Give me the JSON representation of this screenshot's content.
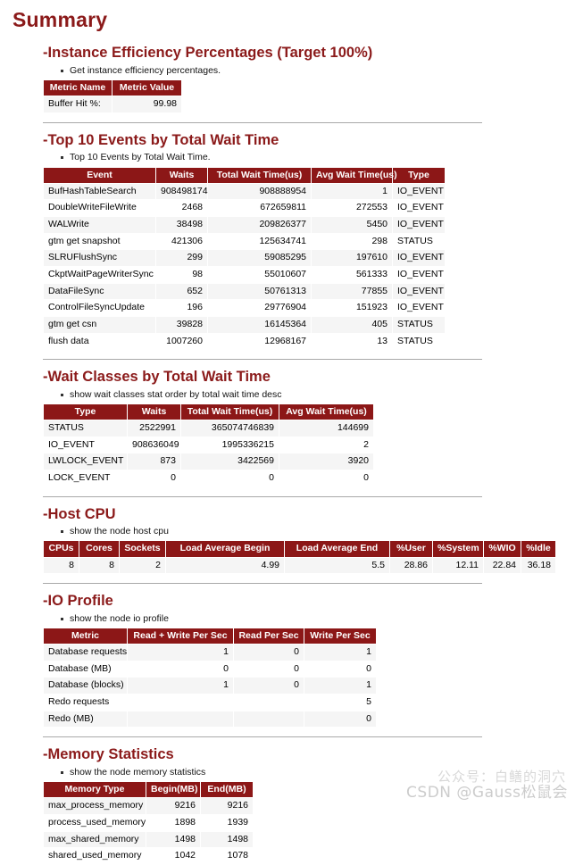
{
  "document": {
    "title": "Summary"
  },
  "theme": {
    "header_bg": "#8C1717",
    "title_color": "#8B1A1A",
    "row_alt_bg": "#f5f5f5",
    "divider_color": "#a9a9a9"
  },
  "sections": {
    "efficiency": {
      "title": "-Instance Efficiency Percentages (Target 100%)",
      "description": "Get instance efficiency percentages.",
      "columns": [
        "Metric Name",
        "Metric Value"
      ],
      "rows": [
        [
          "Buffer Hit %:",
          "99.98"
        ]
      ]
    },
    "top_events": {
      "title": "-Top 10 Events by Total Wait Time",
      "description": "Top 10 Events by Total Wait Time.",
      "columns": [
        "Event",
        "Waits",
        "Total Wait Time(us)",
        "Avg Wait Time(us)",
        "Type"
      ],
      "rows": [
        [
          "BufHashTableSearch",
          "908498174",
          "908888954",
          "1",
          "IO_EVENT"
        ],
        [
          "DoubleWriteFileWrite",
          "2468",
          "672659811",
          "272553",
          "IO_EVENT"
        ],
        [
          "WALWrite",
          "38498",
          "209826377",
          "5450",
          "IO_EVENT"
        ],
        [
          "gtm get snapshot",
          "421306",
          "125634741",
          "298",
          "STATUS"
        ],
        [
          "SLRUFlushSync",
          "299",
          "59085295",
          "197610",
          "IO_EVENT"
        ],
        [
          "CkptWaitPageWriterSync",
          "98",
          "55010607",
          "561333",
          "IO_EVENT"
        ],
        [
          "DataFileSync",
          "652",
          "50761313",
          "77855",
          "IO_EVENT"
        ],
        [
          "ControlFileSyncUpdate",
          "196",
          "29776904",
          "151923",
          "IO_EVENT"
        ],
        [
          "gtm get csn",
          "39828",
          "16145364",
          "405",
          "STATUS"
        ],
        [
          "flush data",
          "1007260",
          "12968167",
          "13",
          "STATUS"
        ]
      ]
    },
    "wait_classes": {
      "title": "-Wait Classes by Total Wait Time",
      "description": "show wait classes stat order by total wait time desc",
      "columns": [
        "Type",
        "Waits",
        "Total Wait Time(us)",
        "Avg Wait Time(us)"
      ],
      "rows": [
        [
          "STATUS",
          "2522991",
          "365074746839",
          "144699"
        ],
        [
          "IO_EVENT",
          "908636049",
          "1995336215",
          "2"
        ],
        [
          "LWLOCK_EVENT",
          "873",
          "3422569",
          "3920"
        ],
        [
          "LOCK_EVENT",
          "0",
          "0",
          "0"
        ]
      ]
    },
    "host_cpu": {
      "title": "-Host CPU",
      "description": "show the node host cpu",
      "columns": [
        "CPUs",
        "Cores",
        "Sockets",
        "Load Average Begin",
        "Load Average End",
        "%User",
        "%System",
        "%WIO",
        "%Idle"
      ],
      "rows": [
        [
          "8",
          "8",
          "2",
          "4.99",
          "5.5",
          "28.86",
          "12.11",
          "22.84",
          "36.18"
        ]
      ]
    },
    "io_profile": {
      "title": "-IO Profile",
      "description": "show the node io profile",
      "columns": [
        "Metric",
        "Read + Write Per Sec",
        "Read Per Sec",
        "Write Per Sec"
      ],
      "rows": [
        [
          "Database requests",
          "1",
          "0",
          "1"
        ],
        [
          "Database (MB)",
          "0",
          "0",
          "0"
        ],
        [
          "Database (blocks)",
          "1",
          "0",
          "1"
        ],
        [
          "Redo requests",
          "",
          "",
          "5"
        ],
        [
          "Redo (MB)",
          "",
          "",
          "0"
        ]
      ]
    },
    "memory": {
      "title": "-Memory Statistics",
      "description": "show the node memory statistics",
      "columns": [
        "Memory Type",
        "Begin(MB)",
        "End(MB)"
      ],
      "rows": [
        [
          "max_process_memory",
          "9216",
          "9216"
        ],
        [
          "process_used_memory",
          "1898",
          "1939"
        ],
        [
          "max_shared_memory",
          "1498",
          "1498"
        ],
        [
          "shared_used_memory",
          "1042",
          "1078"
        ]
      ]
    }
  },
  "watermark": {
    "line1": "公众号：白鳝的洞穴",
    "line2": "CSDN @Gauss松鼠会"
  }
}
